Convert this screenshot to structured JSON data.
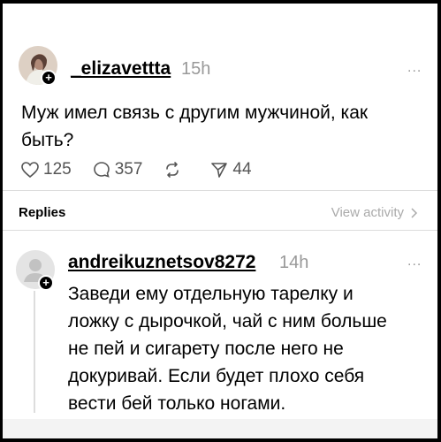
{
  "post": {
    "username": "_elizavettta",
    "time": "15h",
    "more": "...",
    "text": "Муж имел связь с другим мужчиной, как быть?",
    "likes": "125",
    "comments": "357",
    "shares": "44"
  },
  "replies_bar": {
    "label": "Replies",
    "view_activity": "View activity"
  },
  "reply": {
    "username": "andreikuznetsov8272",
    "time": "14h",
    "more": "...",
    "text": "Заведи ему отдельную тарелку и ложку с дырочкой, чай с ним больше не пей и сигарету после него не докуривай. Если будет плохо себя вести бей только ногами."
  }
}
